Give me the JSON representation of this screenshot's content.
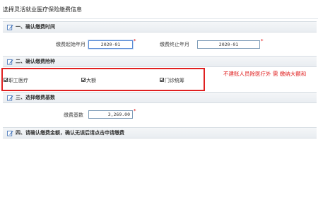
{
  "page": {
    "title": "选择灵活就业医疗保险缴费信息"
  },
  "sections": [
    {
      "title": "一、确认缴费时间"
    },
    {
      "title": "二、确认缴费险种"
    },
    {
      "title": "三、选择缴费基数"
    },
    {
      "title": "四、请确认缴费金额，确认无误后请点击申请缴费"
    }
  ],
  "payment_time": {
    "start_label": "缴费起始年月",
    "start_value": "2020-01",
    "end_label": "缴费终止年月",
    "end_value": "2020-01",
    "required_mark": "*"
  },
  "insurance_types": {
    "items": [
      {
        "label": "职工医疗",
        "checked": true
      },
      {
        "label": "大额",
        "checked": true
      },
      {
        "label": "门诊统筹",
        "checked": true
      }
    ],
    "note": "不建账人员除医疗外 需 缴纳大额和"
  },
  "payment_base": {
    "label": "缴费基数",
    "value": "3,269.00",
    "required_mark": "*"
  },
  "colors": {
    "accent_red": "#e02020",
    "section_bg": "#e9edf1",
    "input_border": "#7f9db9"
  }
}
